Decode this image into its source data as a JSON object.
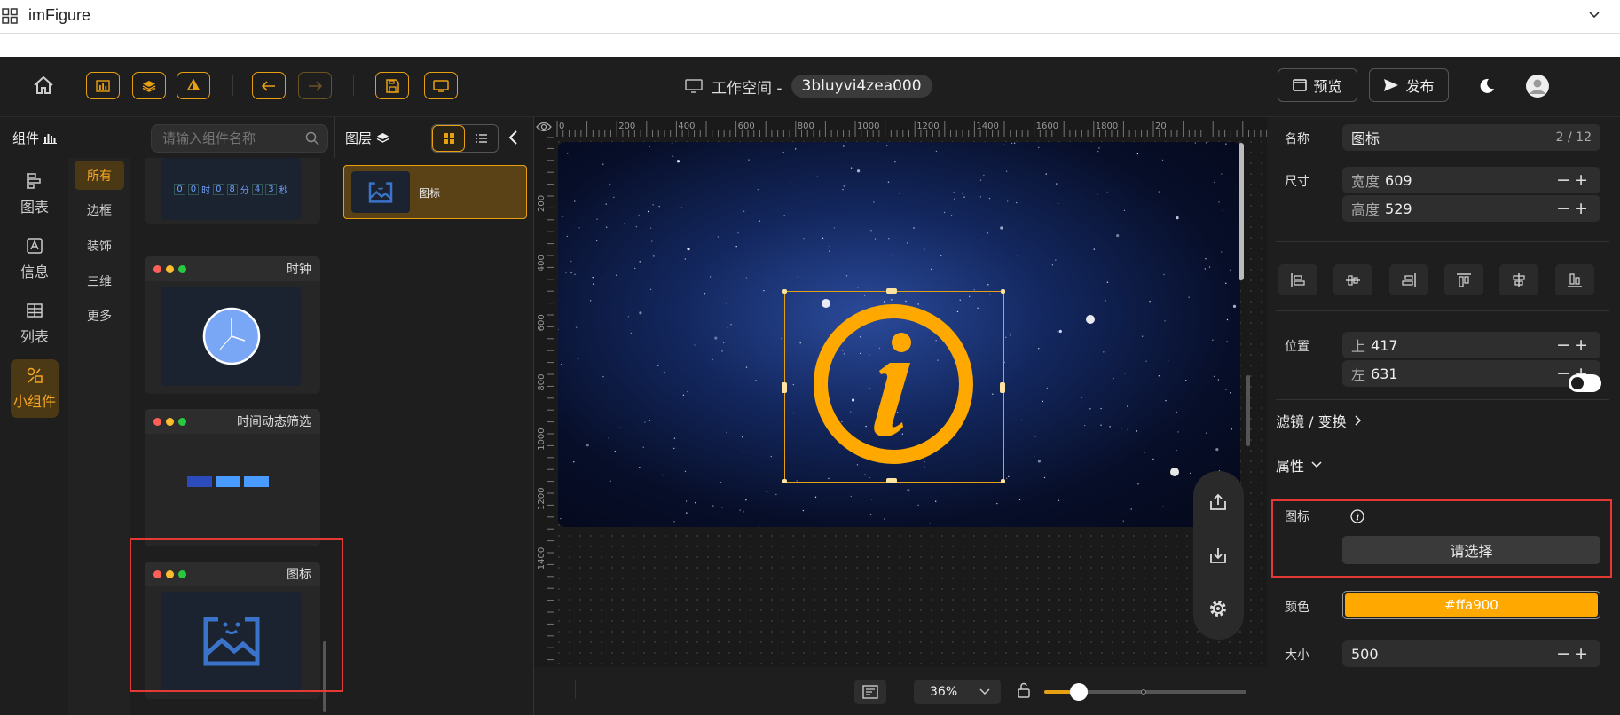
{
  "window": {
    "title": "imFigure"
  },
  "workspace": {
    "label": "工作空间 -",
    "id": "3bluyvi4zea000"
  },
  "header": {
    "preview_label": "预览",
    "publish_label": "发布"
  },
  "components_panel": {
    "title": "组件",
    "search_placeholder": "请输入组件名称",
    "categories": [
      {
        "label": "图表",
        "icon": "chart-icon"
      },
      {
        "label": "信息",
        "icon": "info-text-icon"
      },
      {
        "label": "列表",
        "icon": "table-icon"
      },
      {
        "label": "小组件",
        "icon": "widget-icon",
        "active": true
      }
    ],
    "subcategories": [
      "所有",
      "边框",
      "装饰",
      "三维",
      "更多"
    ],
    "countdown_text": [
      "0",
      "0",
      "时",
      "0",
      "8",
      "分",
      "4",
      "3",
      "秒"
    ],
    "cards": [
      {
        "name": "时钟"
      },
      {
        "name": "时间动态筛选"
      },
      {
        "name": "图标"
      }
    ]
  },
  "layers_panel": {
    "title": "图层",
    "items": [
      {
        "name": "图标"
      }
    ]
  },
  "ruler": {
    "top_ticks": [
      "0",
      "200",
      "400",
      "600",
      "800",
      "1000",
      "1200",
      "1400",
      "1600",
      "1800",
      "20"
    ],
    "left_ticks": [
      "200",
      "400",
      "600",
      "800",
      "1000",
      "1200",
      "1400"
    ]
  },
  "bottom_bar": {
    "zoom": "36%"
  },
  "properties": {
    "name_label": "名称",
    "name_value": "图标",
    "name_count": "2 / 12",
    "size_label": "尺寸",
    "width_label": "宽度",
    "width_value": "609",
    "height_label": "高度",
    "height_value": "529",
    "position_label": "位置",
    "top_label": "上",
    "top_value": "417",
    "left_label": "左",
    "left_value": "631",
    "filter_label": "滤镜 / 变换",
    "attr_label": "属性",
    "icon_label": "图标",
    "choose_label": "请选择",
    "color_label": "颜色",
    "color_value": "#ffa900",
    "size2_label": "大小",
    "size2_value": "500"
  },
  "colors": {
    "accent": "#e8a013",
    "icon_color": "#ffa900",
    "highlight": "#e53935"
  }
}
